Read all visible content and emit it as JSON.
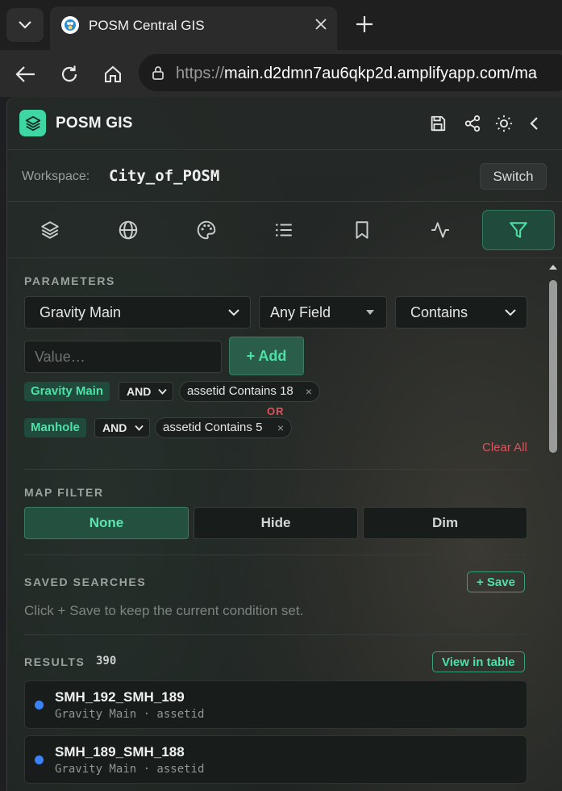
{
  "browser": {
    "tab_title": "POSM Central GIS",
    "url_scheme": "https://",
    "url_rest": "main.d2dmn7au6qkp2d.amplifyapp.com/ma"
  },
  "app": {
    "title": "POSM GIS",
    "accent": "#3ed6a2",
    "workspace_label": "Workspace:",
    "workspace_value": "City_of_POSM",
    "switch_label": "Switch",
    "tools": [
      "layers-icon",
      "globe-icon",
      "palette-icon",
      "list-icon",
      "bookmark-icon",
      "activity-icon",
      "filter-icon"
    ],
    "active_tool": "filter-icon"
  },
  "parameters": {
    "label": "PARAMETERS",
    "layer_select": "Gravity Main",
    "field_select": "Any Field",
    "operator_select": "Contains",
    "value_placeholder": "Value…",
    "add_label": "+ Add",
    "conditions": [
      {
        "layer": "Gravity Main",
        "logic": "AND",
        "condition": "assetid Contains 18",
        "remove": "×"
      },
      {
        "layer": "Manhole",
        "logic": "AND",
        "condition": "assetid Contains 5",
        "remove": "×"
      }
    ],
    "or_label": "OR",
    "clear_all": "Clear All"
  },
  "map_filter": {
    "label": "MAP FILTER",
    "options": [
      "None",
      "Hide",
      "Dim"
    ],
    "selected": "None"
  },
  "saved_searches": {
    "label": "SAVED SEARCHES",
    "save_label": "+ Save",
    "hint": "Click + Save to keep the current condition set."
  },
  "results": {
    "label": "RESULTS",
    "count": "390",
    "view_table": "View in table",
    "items": [
      {
        "name": "SMH_192_SMH_189",
        "sub": "Gravity Main · assetid"
      },
      {
        "name": "SMH_189_SMH_188",
        "sub": "Gravity Main · assetid"
      }
    ]
  }
}
